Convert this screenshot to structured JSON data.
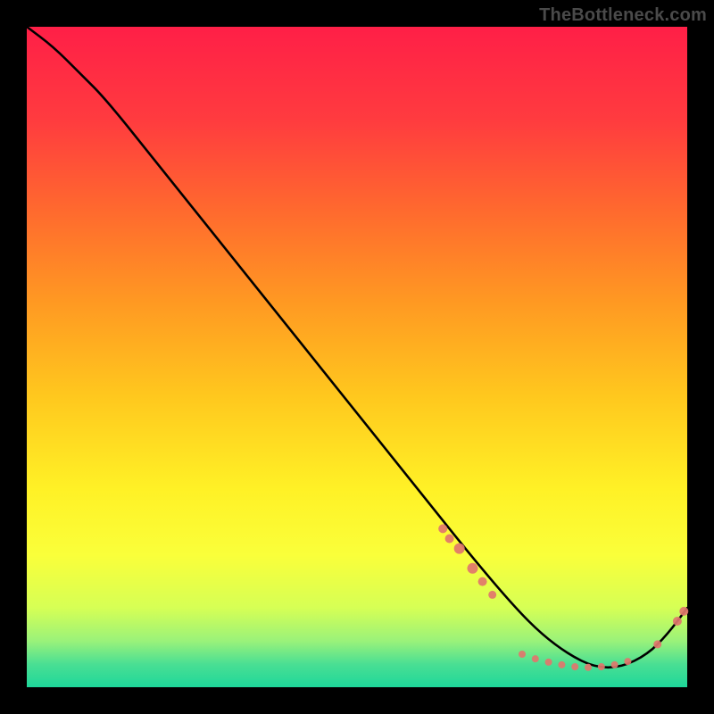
{
  "watermark": "TheBottleneck.com",
  "colors": {
    "dot": "#e1766d",
    "dot_dark": "#c95b54",
    "line": "#000000",
    "black": "#000000",
    "gradient_stops": [
      {
        "offset": 0.0,
        "color": "#ff1f47"
      },
      {
        "offset": 0.14,
        "color": "#ff3b3f"
      },
      {
        "offset": 0.28,
        "color": "#ff6a2e"
      },
      {
        "offset": 0.42,
        "color": "#ff9a22"
      },
      {
        "offset": 0.56,
        "color": "#ffc81e"
      },
      {
        "offset": 0.7,
        "color": "#fff126"
      },
      {
        "offset": 0.8,
        "color": "#faff3a"
      },
      {
        "offset": 0.88,
        "color": "#d6ff55"
      },
      {
        "offset": 0.93,
        "color": "#9af27a"
      },
      {
        "offset": 0.965,
        "color": "#4adf93"
      },
      {
        "offset": 1.0,
        "color": "#1ed79a"
      }
    ]
  },
  "chart_data": {
    "type": "line",
    "title": "",
    "xlabel": "",
    "ylabel": "",
    "xlim": [
      0,
      100
    ],
    "ylim": [
      0,
      100
    ],
    "grid": false,
    "legend": false,
    "series": [
      {
        "name": "curve",
        "x": [
          0,
          4,
          8,
          12,
          20,
          30,
          40,
          50,
          60,
          68,
          74,
          78,
          82,
          86,
          90,
          94,
          97,
          100
        ],
        "y": [
          100,
          97,
          93,
          89,
          79,
          66.5,
          54,
          41.5,
          29,
          19,
          12,
          8,
          5,
          3,
          3,
          5,
          8,
          12
        ]
      }
    ],
    "points": [
      {
        "name": "cluster-descent",
        "x": 63,
        "y": 24,
        "r": 5
      },
      {
        "name": "cluster-descent",
        "x": 64,
        "y": 22.5,
        "r": 5
      },
      {
        "name": "cluster-descent",
        "x": 65.5,
        "y": 21,
        "r": 6
      },
      {
        "name": "cluster-descent",
        "x": 67.5,
        "y": 18,
        "r": 6
      },
      {
        "name": "cluster-descent",
        "x": 69,
        "y": 16,
        "r": 5
      },
      {
        "name": "cluster-descent",
        "x": 70.5,
        "y": 14,
        "r": 4.5
      },
      {
        "name": "valley-floor",
        "x": 75,
        "y": 5,
        "r": 4
      },
      {
        "name": "valley-floor",
        "x": 77,
        "y": 4.3,
        "r": 4
      },
      {
        "name": "valley-floor",
        "x": 79,
        "y": 3.8,
        "r": 4
      },
      {
        "name": "valley-floor",
        "x": 81,
        "y": 3.4,
        "r": 4
      },
      {
        "name": "valley-floor",
        "x": 83,
        "y": 3.1,
        "r": 4
      },
      {
        "name": "valley-floor",
        "x": 85,
        "y": 3.0,
        "r": 4
      },
      {
        "name": "valley-floor",
        "x": 87,
        "y": 3.1,
        "r": 4
      },
      {
        "name": "valley-floor",
        "x": 89,
        "y": 3.4,
        "r": 4
      },
      {
        "name": "valley-floor",
        "x": 91,
        "y": 3.9,
        "r": 4
      },
      {
        "name": "ascent",
        "x": 95.5,
        "y": 6.5,
        "r": 4.5
      },
      {
        "name": "ascent",
        "x": 98.5,
        "y": 10,
        "r": 5
      },
      {
        "name": "ascent",
        "x": 99.5,
        "y": 11.5,
        "r": 5
      }
    ]
  }
}
